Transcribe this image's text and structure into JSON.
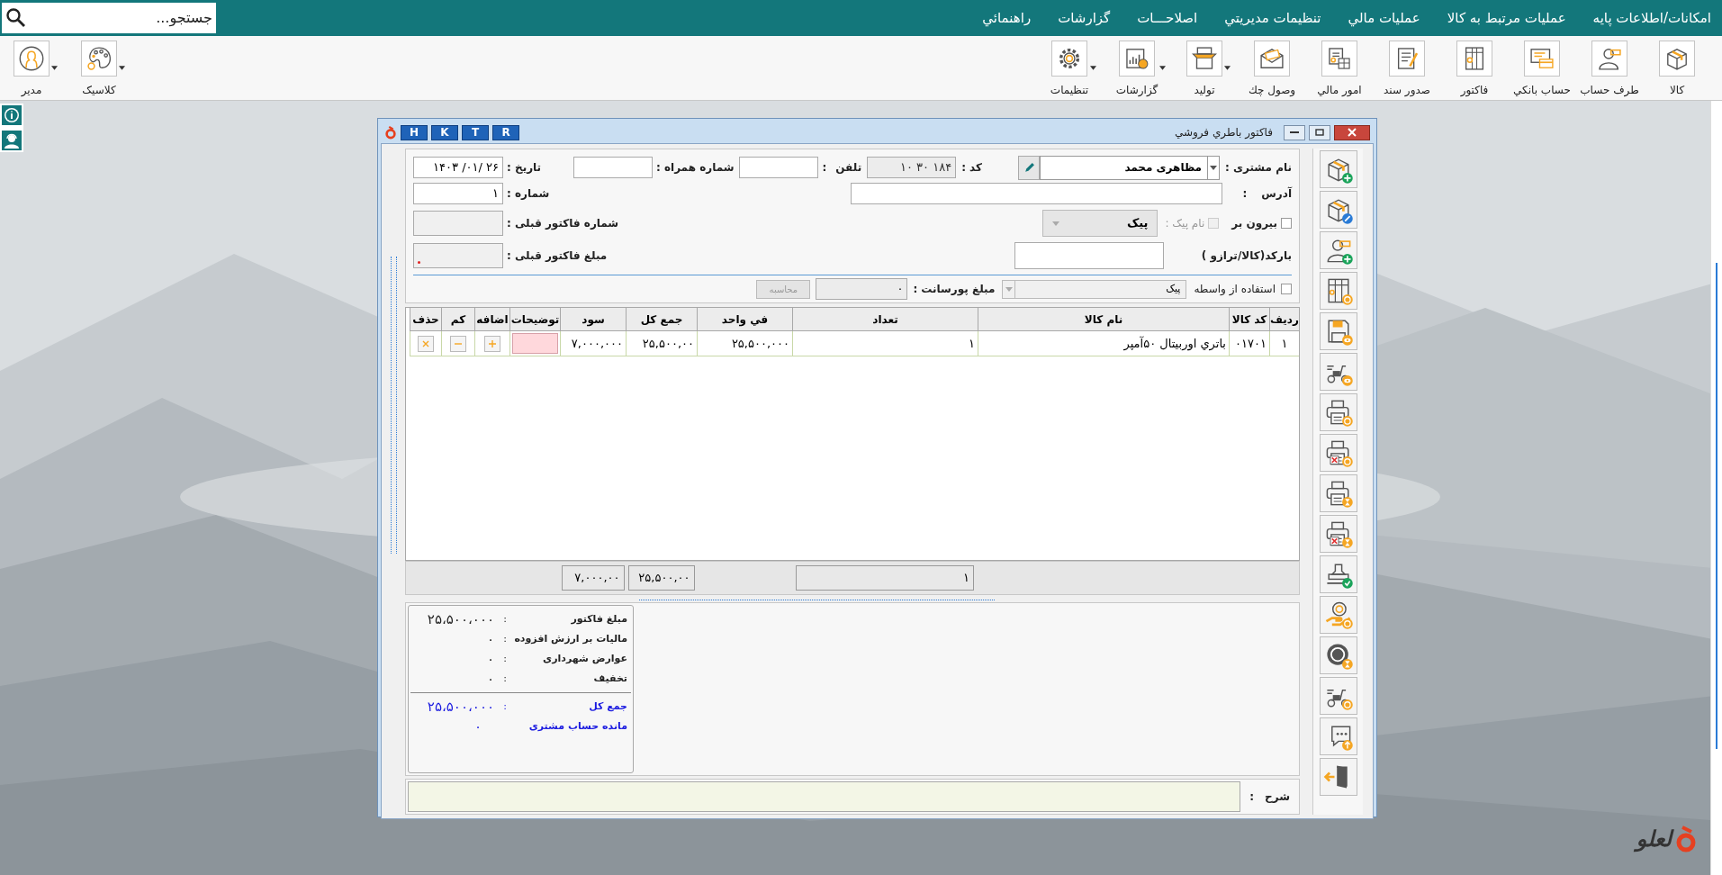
{
  "search": {
    "placeholder": "جستجو..."
  },
  "menu": [
    "امکانات/اطلاعات پايه",
    "عمليات مرتبط به كالا",
    "عمليات مالي",
    "تنظيمات مديريتي",
    "اصلاحـــات",
    "گزارشات",
    "راهنمائي"
  ],
  "toolbar": [
    {
      "label": "كالا",
      "caret": false
    },
    {
      "label": "طرف حساب",
      "caret": false
    },
    {
      "label": "حساب بانکي",
      "caret": false
    },
    {
      "label": "فاکتور",
      "caret": false
    },
    {
      "label": "صدور سند",
      "caret": false
    },
    {
      "label": "امور مالي",
      "caret": false
    },
    {
      "label": "وصول چك",
      "caret": false
    },
    {
      "label": "توليد",
      "caret": true
    },
    {
      "label": "گزارشات",
      "caret": true
    },
    {
      "label": "تنظيمات",
      "caret": true
    }
  ],
  "toolbar_left": [
    {
      "label": "كلاسيک",
      "caret": true
    },
    {
      "label": "مدير",
      "caret": true
    }
  ],
  "window": {
    "title": "فاکتور باطري فروشي",
    "quick_buttons": [
      "R",
      "T",
      "K",
      "H"
    ]
  },
  "customer": {
    "label": "نام مشتری :",
    "value": "مظاهری محمد"
  },
  "code": {
    "label": "کد :",
    "value": "۱۰ ۳۰ ۱۸۴"
  },
  "phone": {
    "label": "تلفن",
    "separator": ":"
  },
  "mobile": {
    "label": "شماره همراه :"
  },
  "date": {
    "label": "تاریخ :",
    "value": "۱۴۰۳ /۰۱/ ۲۶"
  },
  "address": {
    "label": "آدرس",
    "separator": ":"
  },
  "number": {
    "label": "شماره :",
    "value": "۱"
  },
  "outside": {
    "label": "بیرون بر",
    "checked": false
  },
  "courier": {
    "label": "نام پیک :",
    "checked": false,
    "disabled": true
  },
  "courier_select": {
    "value": "پیک",
    "disabled": true
  },
  "prev_invoice_number": {
    "label": "شماره فاکتور قبلی :"
  },
  "barcode": {
    "label": "بارکد(کالا/ترازو )"
  },
  "prev_invoice_amount": {
    "label": "مبلغ فاکتور قبلی :"
  },
  "agent": {
    "label": "استفاده از واسطه",
    "checked": false
  },
  "agent_select": {
    "value": "پیک"
  },
  "commission": {
    "label": "مبلغ پورسانت :",
    "value": "۰"
  },
  "calculate_button": {
    "label": "محاسبه",
    "disabled": true
  },
  "table": {
    "columns": [
      "ردیف",
      "کد کالا",
      "نام کالا",
      "تعداد",
      "في واحد",
      "جمع کل",
      "سود",
      "توضیحات",
      "اضافه",
      "کم",
      "حذف"
    ],
    "rows": [
      {
        "cells": [
          "۱",
          "۰۱۷۰۱",
          "باتري اوربيتال ۵۰آمپر",
          "۱",
          "۲۵,۵۰۰,۰۰۰",
          "۲۵,۵۰۰,۰۰",
          "۷,۰۰۰,۰۰۰"
        ]
      }
    ]
  },
  "totals": {
    "quantity": "۱",
    "total": "۲۵,۵۰۰,۰۰",
    "profit": "۷,۰۰۰,۰۰"
  },
  "summary": [
    {
      "label": "مبلغ فاکتور",
      "separator": ":",
      "value": "۲۵،۵۰۰،۰۰۰",
      "emphasis": false,
      "rule_above": false
    },
    {
      "label": "ماليات بر ارزش افزوده",
      "separator": ":",
      "value": "۰",
      "emphasis": false,
      "rule_above": false
    },
    {
      "label": "عوارض شهرداری",
      "separator": ":",
      "value": "۰",
      "emphasis": false,
      "rule_above": false
    },
    {
      "label": "تخفیف",
      "separator": ":",
      "value": "۰",
      "emphasis": false,
      "rule_above": false
    },
    {
      "label": "جمع کل",
      "separator": ":",
      "value": "۲۵،۵۰۰،۰۰۰",
      "emphasis": true,
      "rule_above": true
    },
    {
      "label": "مانده حساب مشتری",
      "value": "۰",
      "emphasis": true,
      "rule_above": false
    }
  ],
  "description": {
    "label": "شرح",
    "separator": ":"
  },
  "logo": {
    "text": "لعلو"
  }
}
